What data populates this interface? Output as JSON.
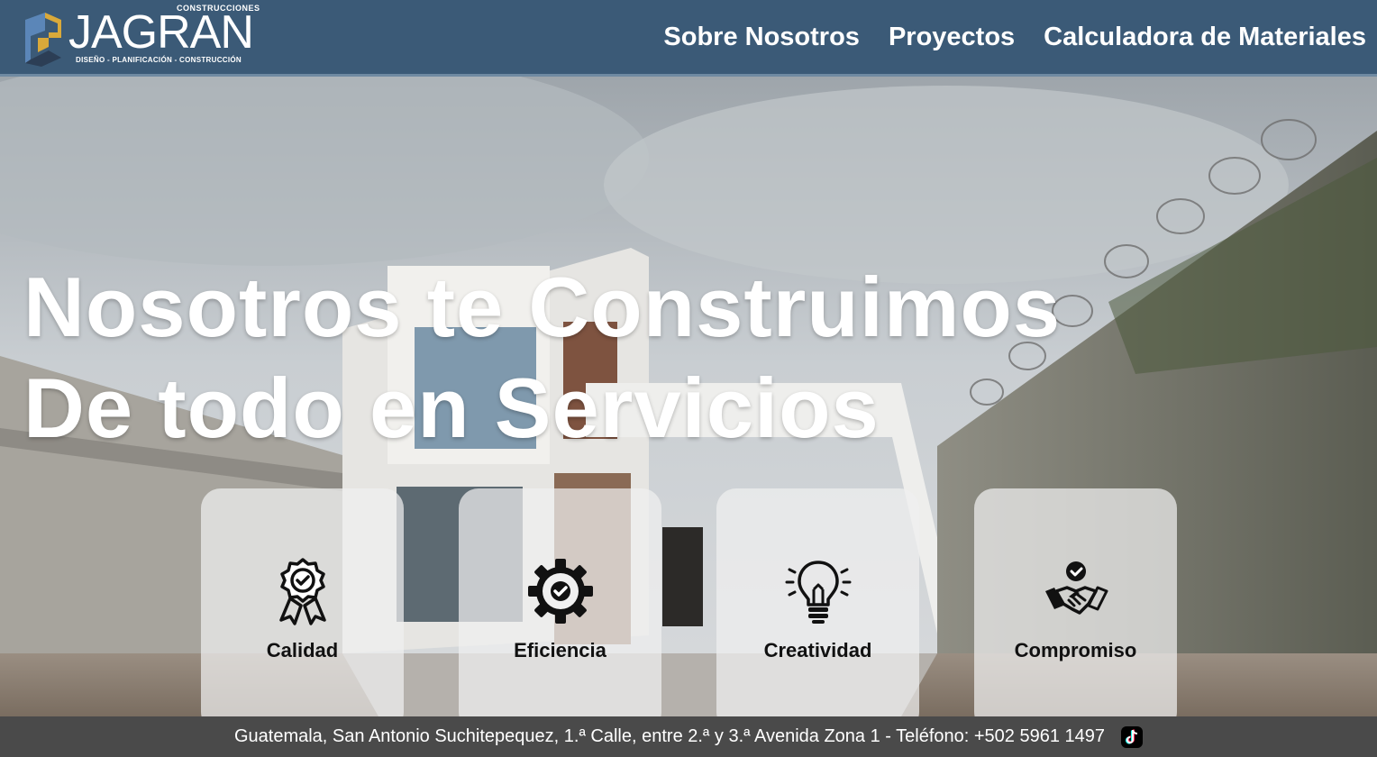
{
  "header": {
    "logo": {
      "superscript": "CONSTRUCCIONES",
      "name": "JAGRAN",
      "tagline": "DISEÑO - PLANIFICACIÓN - CONSTRUCCIÓN"
    },
    "nav": [
      {
        "label": "Sobre Nosotros"
      },
      {
        "label": "Proyectos"
      },
      {
        "label": "Calculadora de Materiales"
      }
    ]
  },
  "hero": {
    "headline_line1": "Nosotros te Construimos",
    "headline_line2": "De todo en Servicios",
    "background": "house-construction-photo",
    "cards": [
      {
        "icon": "quality-badge-icon",
        "label": "Calidad"
      },
      {
        "icon": "gear-check-icon",
        "label": "Eficiencia"
      },
      {
        "icon": "lightbulb-icon",
        "label": "Creatividad"
      },
      {
        "icon": "handshake-icon",
        "label": "Compromiso"
      }
    ]
  },
  "footer": {
    "address": "Guatemala, San Antonio Suchitepequez, 1.ª Calle, entre 2.ª y 3.ª Avenida Zona 1 - Teléfono: +502 5961 1497",
    "social_icon": "tiktok-icon"
  },
  "colors": {
    "header_bg": "#3b5a77",
    "footer_bg": "#4a4a4a",
    "logo_gold": "#d9a93a",
    "logo_blue": "#5b86b8"
  }
}
